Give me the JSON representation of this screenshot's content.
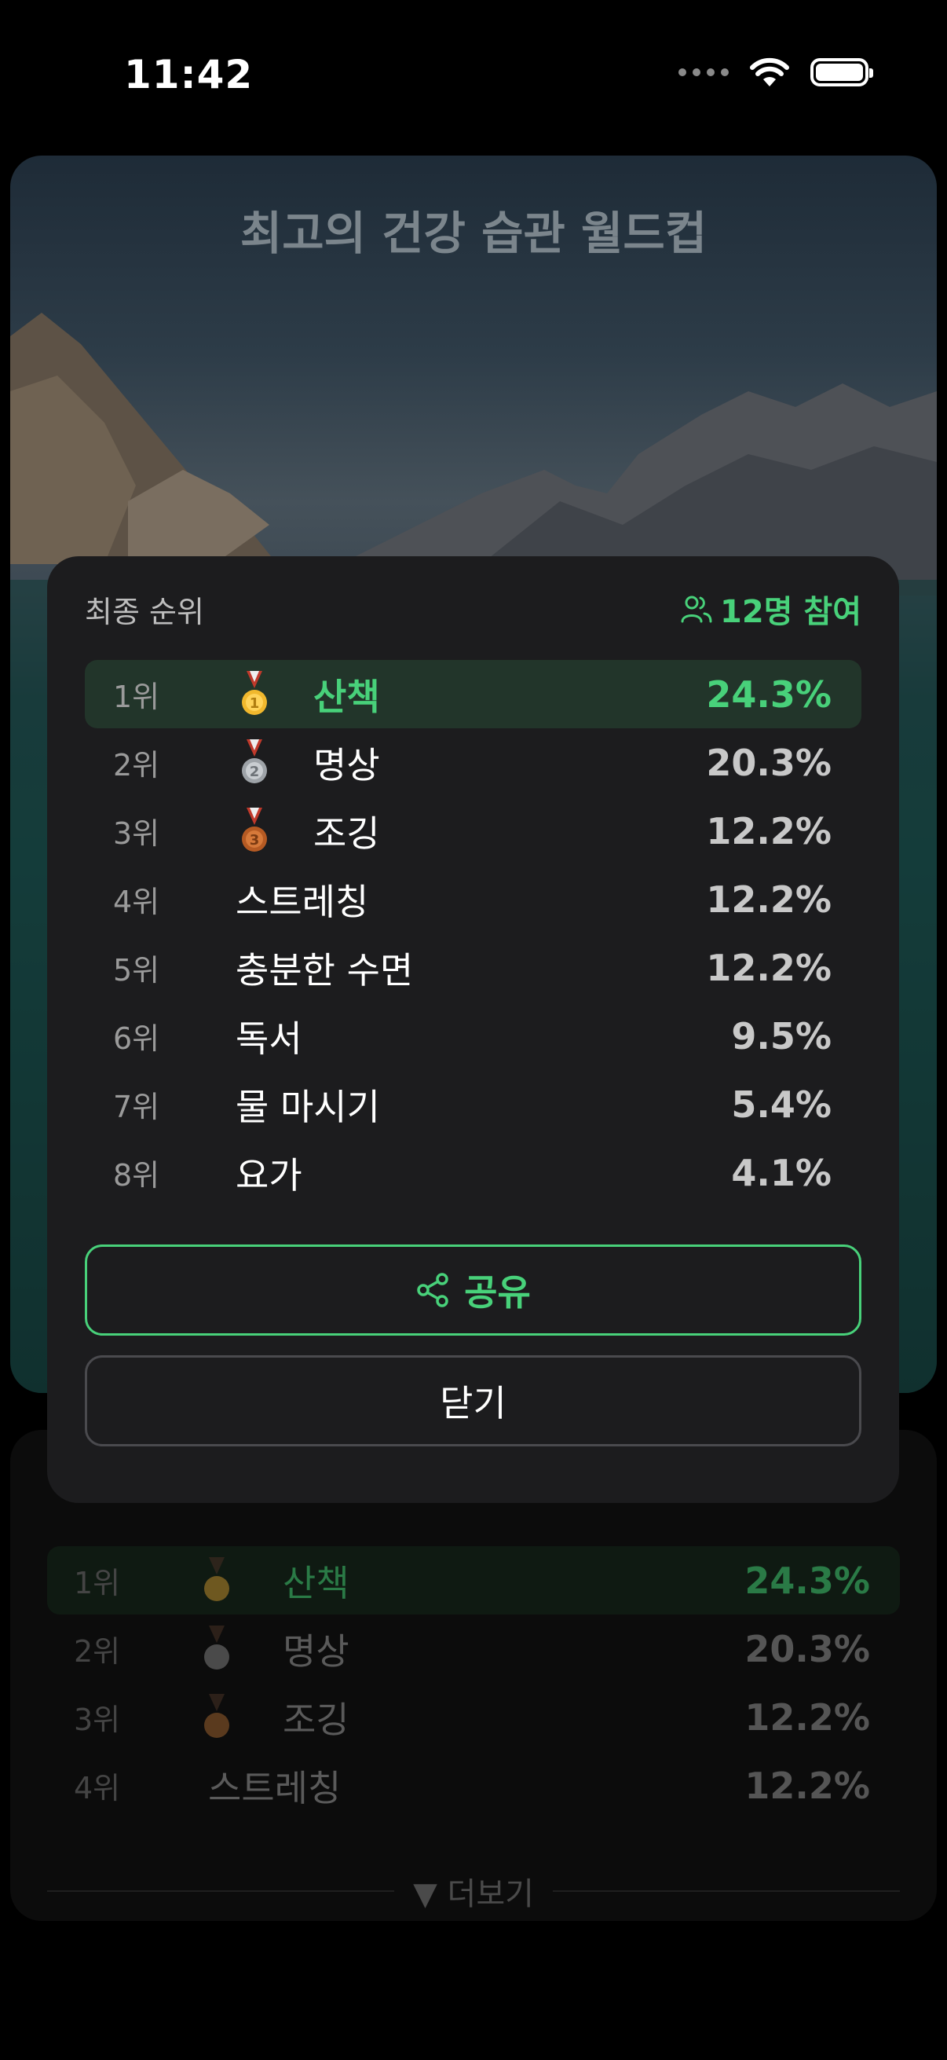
{
  "status_bar": {
    "time": "11:42"
  },
  "hero": {
    "title": "최고의 건강 습관 월드컵"
  },
  "modal": {
    "title": "최종 순위",
    "participants": "12명 참여",
    "rankings": [
      {
        "rank": "1위",
        "name": "산책",
        "percent": "24.3%",
        "medal": "gold"
      },
      {
        "rank": "2위",
        "name": "명상",
        "percent": "20.3%",
        "medal": "silver"
      },
      {
        "rank": "3위",
        "name": "조깅",
        "percent": "12.2%",
        "medal": "bronze"
      },
      {
        "rank": "4위",
        "name": "스트레칭",
        "percent": "12.2%"
      },
      {
        "rank": "5위",
        "name": "충분한 수면",
        "percent": "12.2%"
      },
      {
        "rank": "6위",
        "name": "독서",
        "percent": "9.5%"
      },
      {
        "rank": "7위",
        "name": "물 마시기",
        "percent": "5.4%"
      },
      {
        "rank": "8위",
        "name": "요가",
        "percent": "4.1%"
      }
    ],
    "share_label": "공유",
    "close_label": "닫기"
  },
  "background_panel": {
    "rankings": [
      {
        "rank": "1위",
        "name": "산책",
        "percent": "24.3%",
        "medal": "gold"
      },
      {
        "rank": "2위",
        "name": "명상",
        "percent": "20.3%",
        "medal": "silver"
      },
      {
        "rank": "3위",
        "name": "조깅",
        "percent": "12.2%",
        "medal": "bronze"
      },
      {
        "rank": "4위",
        "name": "스트레칭",
        "percent": "12.2%"
      }
    ],
    "more_label": "▼ 더보기"
  },
  "colors": {
    "accent": "#48d17a",
    "modal_bg": "#1c1c1e",
    "top_row_bg": "#22352a"
  }
}
